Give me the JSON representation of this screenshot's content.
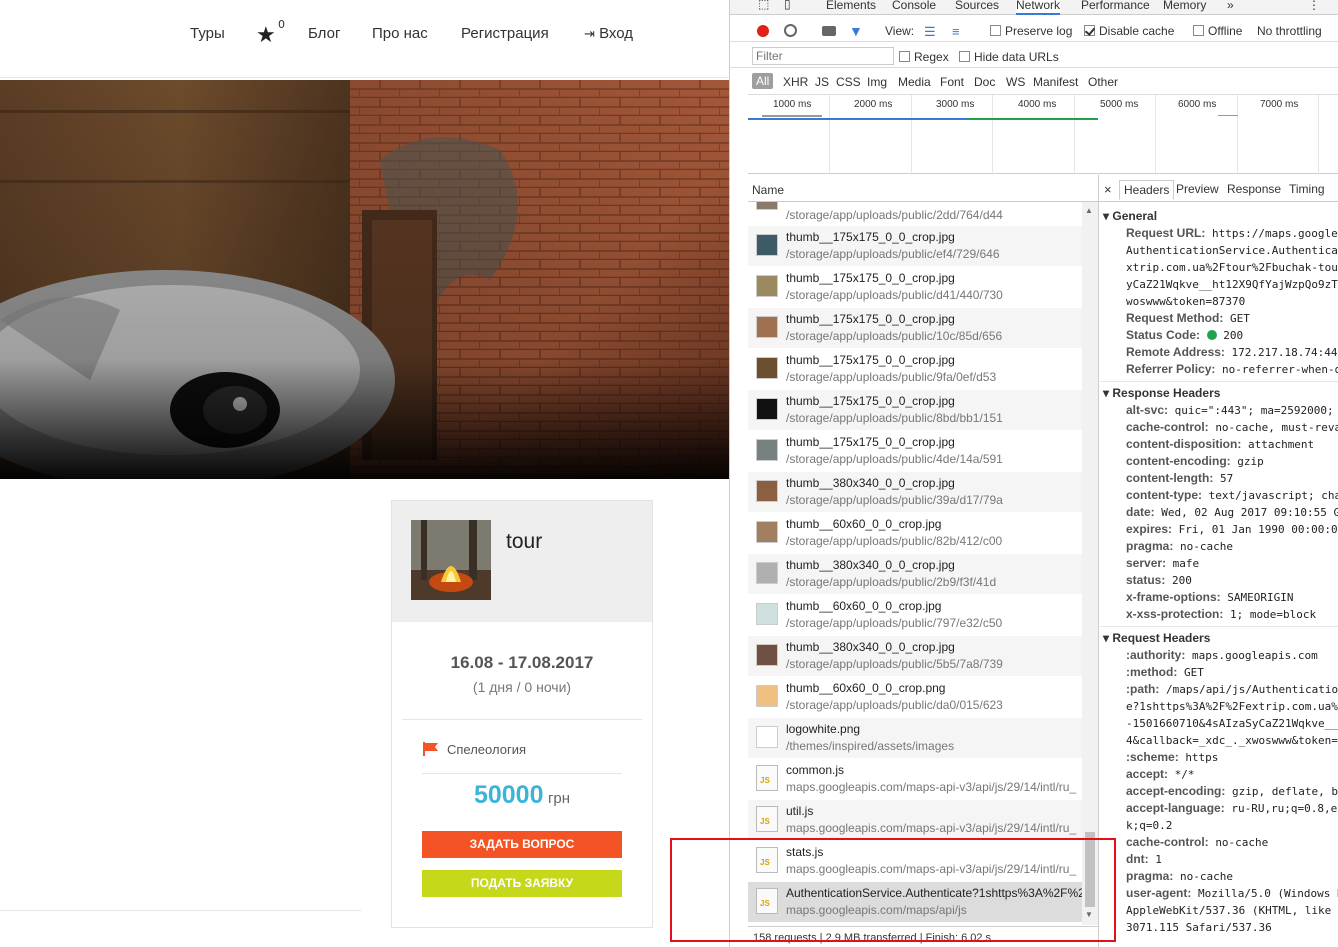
{
  "site": {
    "nav": {
      "tours": "Туры",
      "fav_count": "0",
      "blog": "Блог",
      "about": "Про нас",
      "register": "Регистрация",
      "login": "Вход"
    },
    "card": {
      "title": "tour",
      "dates": "16.08 - 17.08.2017",
      "duration": "(1 дня / 0 ночи)",
      "category": "Спелеология",
      "price": "50000",
      "currency": "грн",
      "ask_button": "ЗАДАТЬ ВОПРОС",
      "apply_button": "ПОДАТЬ ЗАЯВКУ"
    },
    "colors": {
      "price": "#3bb4d8",
      "ask_button": "#f35325",
      "apply_button": "#c6d81a",
      "flag": "#f35325"
    }
  },
  "devtools": {
    "tabs": [
      "Elements",
      "Console",
      "Sources",
      "Network",
      "Performance",
      "Memory"
    ],
    "active_tab": "Network",
    "toolbar": {
      "view_label": "View:",
      "preserve_log": "Preserve log",
      "disable_cache": "Disable cache",
      "offline": "Offline",
      "throttle": "No throttling"
    },
    "filter": {
      "placeholder": "Filter",
      "regex": "Regex",
      "hide_data": "Hide data URLs"
    },
    "types": [
      "All",
      "XHR",
      "JS",
      "CSS",
      "Img",
      "Media",
      "Font",
      "Doc",
      "WS",
      "Manifest",
      "Other"
    ],
    "timeline": [
      "1000 ms",
      "2000 ms",
      "3000 ms",
      "4000 ms",
      "5000 ms",
      "6000 ms",
      "7000 ms"
    ],
    "name_header": "Name",
    "detail_tabs": [
      "Headers",
      "Preview",
      "Response",
      "Timing"
    ],
    "requests": [
      {
        "name": "thumb__175x175_0_0_crop.jpg",
        "path": "/storage/app/uploads/public/ef4/729/646"
      },
      {
        "name": "thumb__175x175_0_0_crop.jpg",
        "path": "/storage/app/uploads/public/d41/440/730"
      },
      {
        "name": "thumb__175x175_0_0_crop.jpg",
        "path": "/storage/app/uploads/public/10c/85d/656"
      },
      {
        "name": "thumb__175x175_0_0_crop.jpg",
        "path": "/storage/app/uploads/public/9fa/0ef/d53"
      },
      {
        "name": "thumb__175x175_0_0_crop.jpg",
        "path": "/storage/app/uploads/public/8bd/bb1/151"
      },
      {
        "name": "thumb__175x175_0_0_crop.jpg",
        "path": "/storage/app/uploads/public/4de/14a/591"
      },
      {
        "name": "thumb__380x340_0_0_crop.jpg",
        "path": "/storage/app/uploads/public/39a/d17/79a"
      },
      {
        "name": "thumb__60x60_0_0_crop.jpg",
        "path": "/storage/app/uploads/public/82b/412/c00"
      },
      {
        "name": "thumb__380x340_0_0_crop.jpg",
        "path": "/storage/app/uploads/public/2b9/f3f/41d"
      },
      {
        "name": "thumb__60x60_0_0_crop.jpg",
        "path": "/storage/app/uploads/public/797/e32/c50"
      },
      {
        "name": "thumb__380x340_0_0_crop.jpg",
        "path": "/storage/app/uploads/public/5b5/7a8/739"
      },
      {
        "name": "thumb__60x60_0_0_crop.png",
        "path": "/storage/app/uploads/public/da0/015/623"
      },
      {
        "name": "logowhite.png",
        "path": "/themes/inspired/assets/images"
      },
      {
        "name": "common.js",
        "path": "maps.googleapis.com/maps-api-v3/api/js/29/14/intl/ru_"
      },
      {
        "name": "util.js",
        "path": "maps.googleapis.com/maps-api-v3/api/js/29/14/intl/ru_"
      },
      {
        "name": "stats.js",
        "path": "maps.googleapis.com/maps-api-v3/api/js/29/14/intl/ru_"
      },
      {
        "name": "AuthenticationService.Authenticate?1shttps%3A%2F%2F",
        "path": "maps.googleapis.com/maps/api/js"
      }
    ],
    "partial_top_path": "/storage/app/uploads/public/2dd/764/d44",
    "status_bar": "158 requests  |  2.9 MB transferred  |  Finish: 6.02 s",
    "general": {
      "title": "General",
      "url_label": "Request URL:",
      "url_lines": [
        "https://maps.googlea",
        "AuthenticationService.Authentica",
        "xtrip.com.ua%2Ftour%2Fbuchak-tou",
        "yCaZ21Wqkve__ht12X9QfYajWzpQo9zT",
        "woswww&token=87370"
      ],
      "method_label": "Request Method:",
      "method": "GET",
      "status_label": "Status Code:",
      "status": "200",
      "remote_label": "Remote Address:",
      "remote": "172.217.18.74:443",
      "referrer_label": "Referrer Policy:",
      "referrer": "no-referrer-when-do"
    },
    "response_headers": {
      "title": "Response Headers",
      "items": [
        [
          "alt-svc:",
          "quic=\":443\"; ma=2592000; v"
        ],
        [
          "cache-control:",
          "no-cache, must-reval"
        ],
        [
          "content-disposition:",
          "attachment"
        ],
        [
          "content-encoding:",
          "gzip"
        ],
        [
          "content-length:",
          "57"
        ],
        [
          "content-type:",
          "text/javascript; cha"
        ],
        [
          "date:",
          "Wed, 02 Aug 2017 09:10:55 G"
        ],
        [
          "expires:",
          "Fri, 01 Jan 1990 00:00:00"
        ],
        [
          "pragma:",
          "no-cache"
        ],
        [
          "server:",
          "mafe"
        ],
        [
          "status:",
          "200"
        ],
        [
          "x-frame-options:",
          "SAMEORIGIN"
        ],
        [
          "x-xss-protection:",
          "1; mode=block"
        ]
      ]
    },
    "request_headers": {
      "title": "Request Headers",
      "items": [
        [
          ":authority:",
          "maps.googleapis.com"
        ],
        [
          ":method:",
          "GET"
        ],
        [
          ":path:",
          "/maps/api/js/Authenticatio"
        ],
        [
          "",
          "e?1shttps%3A%2F%2Fextrip.com.ua%"
        ],
        [
          "",
          "-1501660710&4sAIzaSyCaZ21Wqkve__"
        ],
        [
          "",
          "4&callback=_xdc_._xwoswww&token=8"
        ],
        [
          ":scheme:",
          "https"
        ],
        [
          "accept:",
          "*/*"
        ],
        [
          "accept-encoding:",
          "gzip, deflate, br"
        ],
        [
          "accept-language:",
          "ru-RU,ru;q=0.8,en"
        ],
        [
          "",
          "k;q=0.2"
        ],
        [
          "cache-control:",
          "no-cache"
        ],
        [
          "dnt:",
          "1"
        ],
        [
          "pragma:",
          "no-cache"
        ],
        [
          "user-agent:",
          "Mozilla/5.0 (Windows N"
        ],
        [
          "",
          "AppleWebKit/537.36 (KHTML, like"
        ],
        [
          "",
          "3071.115 Safari/537.36"
        ]
      ]
    }
  }
}
